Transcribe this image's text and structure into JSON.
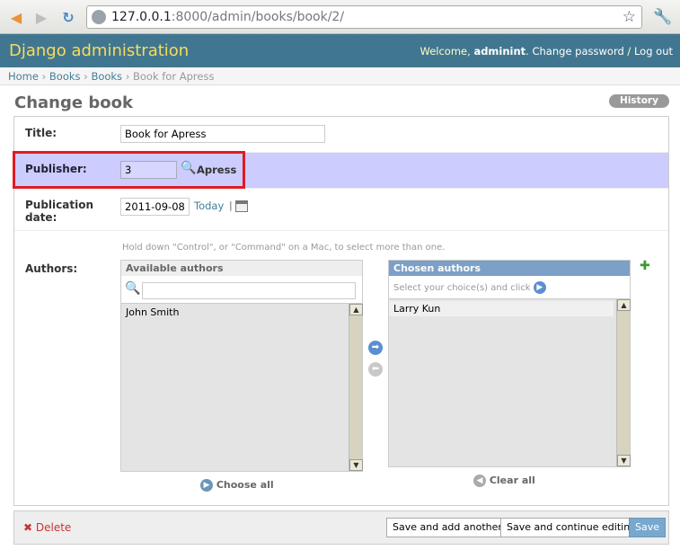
{
  "browser": {
    "url_host": "127.0.0.1",
    "url_rest": ":8000/admin/books/book/2/"
  },
  "header": {
    "branding": "Django administration",
    "welcome": "Welcome, ",
    "username": "adminint",
    "change_password": "Change password",
    "separator": " / ",
    "logout": "Log out"
  },
  "breadcrumbs": {
    "home": "Home",
    "app": "Books",
    "model": "Books",
    "current": "Book for Apress",
    "sep": " › "
  },
  "page": {
    "title": "Change book",
    "history": "History"
  },
  "form": {
    "title_label": "Title:",
    "title_value": "Book for Apress",
    "publisher_label": "Publisher:",
    "publisher_value": "3",
    "publisher_name": "Apress",
    "pubdate_label_1": "Publication",
    "pubdate_label_2": "date:",
    "pubdate_value": "2011-09-08",
    "today": "Today",
    "today_sep": "|",
    "help_text": "Hold down \"Control\", or \"Command\" on a Mac, to select more than one.",
    "authors_label": "Authors:"
  },
  "selector": {
    "available_title": "Available authors",
    "available_options": [
      "John Smith"
    ],
    "chosen_title": "Chosen authors",
    "chosen_help": "Select your choice(s) and click",
    "chosen_options": [
      "Larry Kun"
    ],
    "choose_all": "Choose all",
    "clear_all": "Clear all"
  },
  "submit": {
    "delete": "Delete",
    "save_add_another": "Save and add another",
    "save_continue": "Save and continue editing",
    "save": "Save"
  }
}
